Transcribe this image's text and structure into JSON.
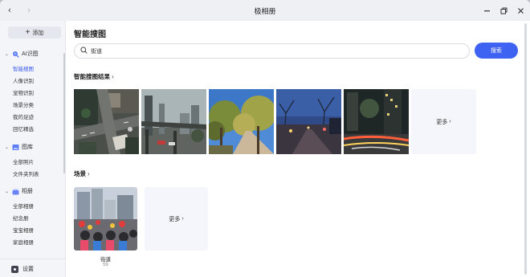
{
  "window": {
    "title": "极相册"
  },
  "sidebar": {
    "add_label": "添加",
    "sections": [
      {
        "label": "AI识图",
        "items": [
          "智能搜图",
          "人像识别",
          "宠物识别",
          "场景分类",
          "我的足迹",
          "回忆精选"
        ]
      },
      {
        "label": "图库",
        "items": [
          "全部照片",
          "文件夹列表"
        ]
      },
      {
        "label": "相册",
        "items": [
          "全部相册",
          "纪念册",
          "宝宝相册",
          "家庭相册"
        ]
      }
    ],
    "active_item": "智能搜图",
    "settings_label": "设置"
  },
  "main": {
    "title": "智能搜图",
    "search": {
      "value": "街道",
      "button": "搜索"
    },
    "results": {
      "title": "智能搜图结果",
      "photos": [
        "street-aerial",
        "city-overpass",
        "tree-lined-road",
        "night-street",
        "night-traffic-blur"
      ],
      "more_label": "更多"
    },
    "scenes": {
      "title": "场景",
      "albums": [
        {
          "name": "街道",
          "count": "59"
        }
      ],
      "more_label": "更多"
    }
  },
  "colors": {
    "accent": "#3e62f2",
    "sidebar_bg": "#f4f5f8",
    "more_tile_bg": "#f4f6fb"
  }
}
